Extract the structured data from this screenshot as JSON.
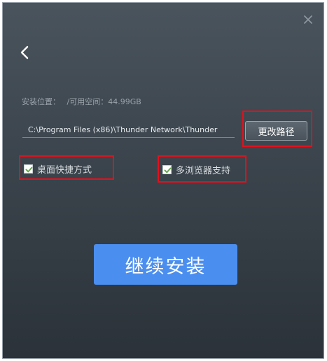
{
  "install": {
    "location_label": "安装位置：",
    "space_label": "/可用空间：44.99GB",
    "path_value": "C:\\Program Files (x86)\\Thunder Network\\Thunder",
    "change_path_label": "更改路径"
  },
  "options": {
    "desktop_shortcut": {
      "label": "桌面快捷方式",
      "checked": true
    },
    "multi_browser": {
      "label": "多浏览器支持",
      "checked": true
    }
  },
  "actions": {
    "continue_label": "继续安装"
  },
  "colors": {
    "accent": "#4a8ef0",
    "highlight": "#e3101c",
    "check": "#6aa84f"
  },
  "icons": {
    "close": "close-icon",
    "back": "chevron-left-icon",
    "check": "checkmark-icon"
  }
}
